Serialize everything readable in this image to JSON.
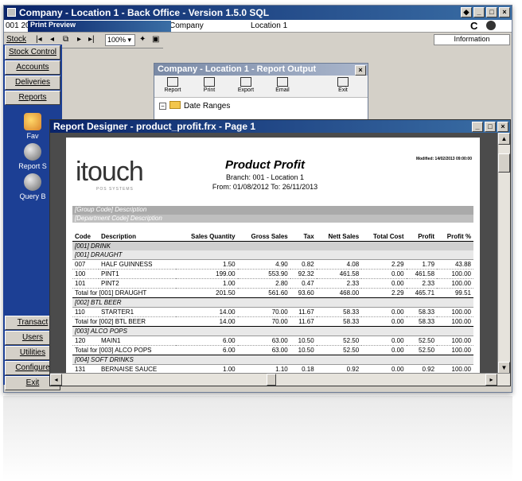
{
  "app": {
    "title": "Company - Location 1 - Back Office - Version 1.5.0 SQL",
    "header": {
      "left": "001  20",
      "company": "Company",
      "location": "Location 1",
      "info_button": "Information",
      "right_c": "C"
    }
  },
  "print_preview": {
    "title": "Print Preview",
    "stock_label": "Stock",
    "zoom": "100%"
  },
  "nav": {
    "buttons": [
      "Stock Control",
      "Accounts",
      "Deliveries",
      "Reports"
    ],
    "groups": [
      "Fav",
      "Report S",
      "Query B"
    ],
    "bottom_buttons": [
      "Transact",
      "Users",
      "Utilities",
      "Configure",
      "Exit"
    ]
  },
  "report_output": {
    "title": "Company - Location 1 - Report Output",
    "tools": [
      "Report",
      "Print",
      "Export",
      "Email",
      "Exit"
    ],
    "tree_item": "Date Ranges"
  },
  "designer": {
    "title": "Report Designer - product_profit.frx - Page 1"
  },
  "report": {
    "logo_text": "itouch",
    "logo_sub": "POS SYSTEMS",
    "title": "Product Profit",
    "branch": "Branch: 001 - Location 1",
    "dates": "From: 01/08/2012   To: 26/11/2013",
    "modified": "Modified: 14/02/2013 09:00:00",
    "group_header": "[Group Code] Description",
    "dept_header": "[Department Code] Description",
    "columns": [
      "Code",
      "Description",
      "Sales Quantity",
      "Gross Sales",
      "Tax",
      "Nett Sales",
      "Total Cost",
      "Profit",
      "Profit %"
    ],
    "rows": [
      {
        "type": "cat",
        "text": "[001] DRINK"
      },
      {
        "type": "sub",
        "text": "[001] DRAUGHT"
      },
      {
        "type": "item",
        "cells": [
          "007",
          "HALF GUINNESS",
          "1.50",
          "4.90",
          "0.82",
          "4.08",
          "2.29",
          "1.79",
          "43.88"
        ]
      },
      {
        "type": "item",
        "cells": [
          "100",
          "PINT1",
          "199.00",
          "553.90",
          "92.32",
          "461.58",
          "0.00",
          "461.58",
          "100.00"
        ]
      },
      {
        "type": "item",
        "cells": [
          "101",
          "PINT2",
          "1.00",
          "2.80",
          "0.47",
          "2.33",
          "0.00",
          "2.33",
          "100.00"
        ]
      },
      {
        "type": "tot",
        "cells": [
          "Total for [001] DRAUGHT",
          "",
          "201.50",
          "561.60",
          "93.60",
          "468.00",
          "2.29",
          "465.71",
          "99.51"
        ]
      },
      {
        "type": "sub",
        "text": "[002] BTL BEER"
      },
      {
        "type": "item",
        "cells": [
          "110",
          "STARTER1",
          "14.00",
          "70.00",
          "11.67",
          "58.33",
          "0.00",
          "58.33",
          "100.00"
        ]
      },
      {
        "type": "tot",
        "cells": [
          "Total for [002] BTL BEER",
          "",
          "14.00",
          "70.00",
          "11.67",
          "58.33",
          "0.00",
          "58.33",
          "100.00"
        ]
      },
      {
        "type": "sub",
        "text": "[003] ALCO POPS"
      },
      {
        "type": "item",
        "cells": [
          "120",
          "MAIN1",
          "6.00",
          "63.00",
          "10.50",
          "52.50",
          "0.00",
          "52.50",
          "100.00"
        ]
      },
      {
        "type": "tot",
        "cells": [
          "Total for [003] ALCO POPS",
          "",
          "6.00",
          "63.00",
          "10.50",
          "52.50",
          "0.00",
          "52.50",
          "100.00"
        ]
      },
      {
        "type": "sub",
        "text": "[004] SOFT DRINKS"
      },
      {
        "type": "item",
        "cells": [
          "131",
          "BERNAISE SAUCE",
          "1.00",
          "1.10",
          "0.18",
          "0.92",
          "0.00",
          "0.92",
          "100.00"
        ]
      }
    ]
  }
}
